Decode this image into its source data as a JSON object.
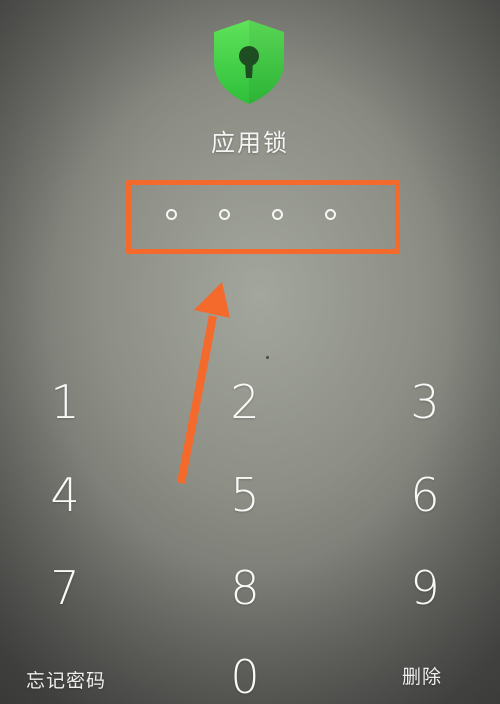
{
  "app": {
    "title": "应用锁"
  },
  "logo": {
    "icon": "shield-keyhole-icon",
    "color": "#4cd94a"
  },
  "pin": {
    "length": 4,
    "filled": 0,
    "highlight_color": "#f46a2c"
  },
  "keypad": {
    "k1": "1",
    "k2": "2",
    "k3": "3",
    "k4": "4",
    "k5": "5",
    "k6": "6",
    "k7": "7",
    "k8": "8",
    "k9": "9",
    "k0": "0"
  },
  "actions": {
    "forgot_password": "忘记密码",
    "delete": "删除"
  },
  "annotation": {
    "arrow_icon": "arrow-up-icon",
    "color": "#f46a2c"
  }
}
